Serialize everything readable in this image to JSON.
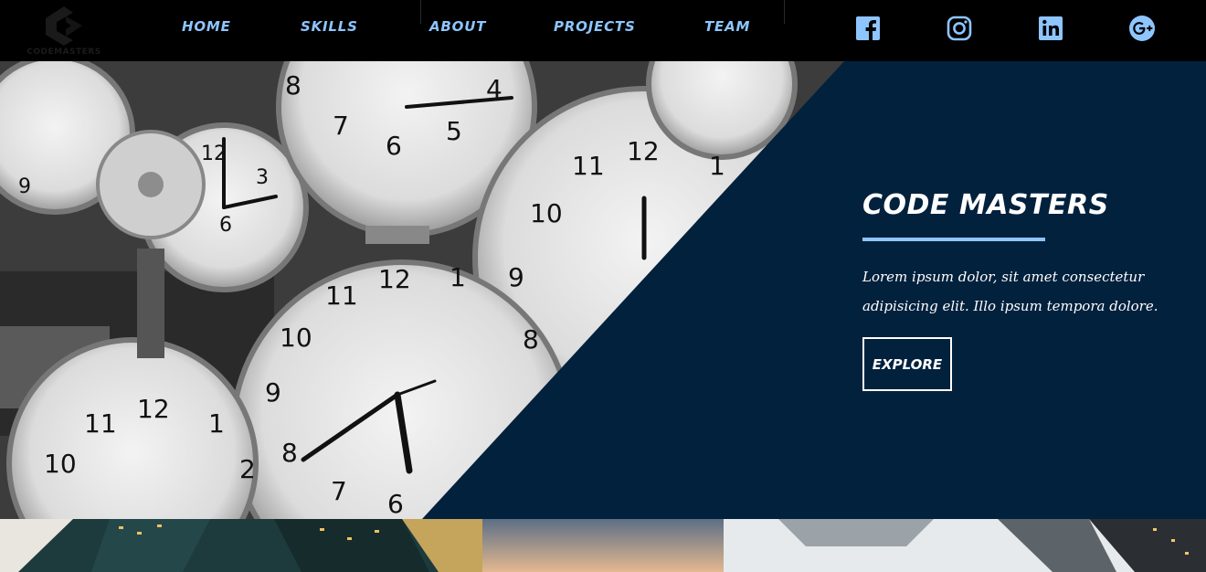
{
  "brand": {
    "logo_text": "CODEMASTERS"
  },
  "nav": {
    "items": [
      {
        "label": "HOME"
      },
      {
        "label": "SKILLS"
      },
      {
        "label": "ABOUT"
      },
      {
        "label": "PROJECTS"
      },
      {
        "label": "TEAM"
      }
    ]
  },
  "social": {
    "icons": [
      "facebook-icon",
      "instagram-icon",
      "linkedin-icon",
      "google-plus-icon"
    ]
  },
  "hero": {
    "title": "CODE MASTERS",
    "description": "Lorem ipsum dolor, sit amet consectetur adipisicing elit. Illo ipsum tempora dolore.",
    "cta_label": "EXPLORE"
  },
  "colors": {
    "accent": "#8ec5ff",
    "navbar": "#000000",
    "hero_panel": "#02213d",
    "text_light": "#ffffff"
  }
}
